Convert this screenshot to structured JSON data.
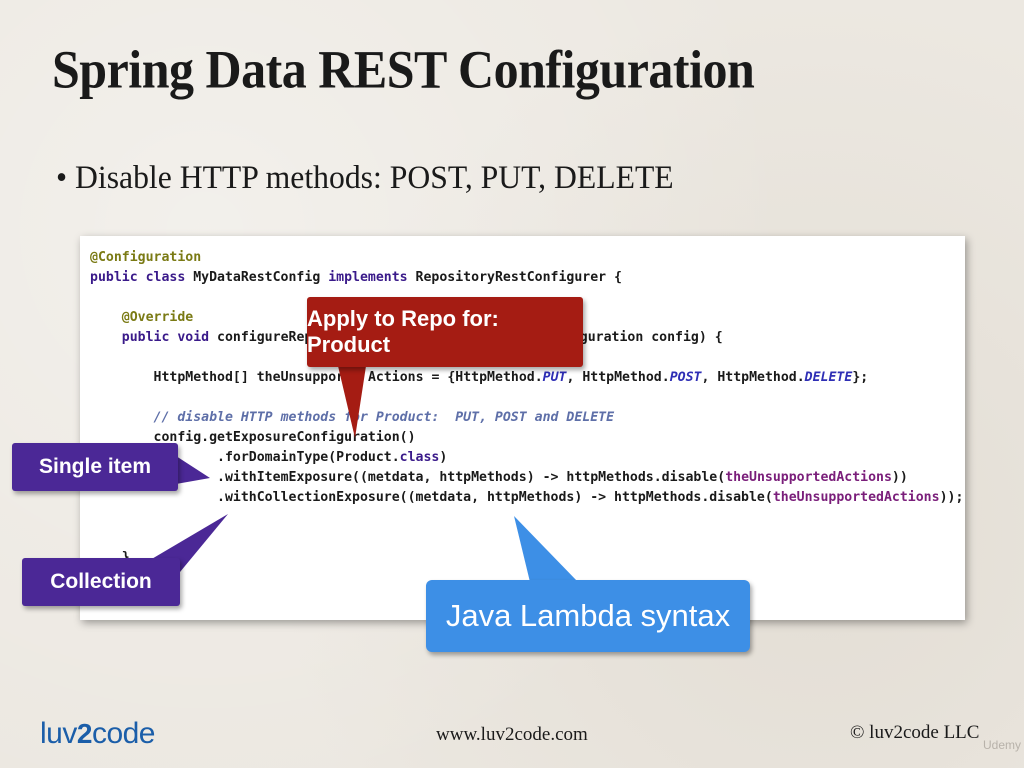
{
  "slide": {
    "title": "Spring Data REST Configuration",
    "bullet": "• Disable HTTP methods: POST, PUT, DELETE"
  },
  "code": {
    "line1": "@Configuration",
    "line2_kw": "public class",
    "line2_a": " MyDataRestConfig ",
    "line2_kw2": "implements",
    "line2_b": " RepositoryRestConfigurer {",
    "line4": "@Override",
    "line5_kw": "public void",
    "line5_a": " configureRepo",
    "line5_b": "estConfiguration config) {",
    "line7_a": "HttpMethod[] theUnsupporte",
    "line7_b": "Actions = {HttpMethod.",
    "line7_put": "PUT",
    "line7_c": ", HttpMethod.",
    "line7_post": "POST",
    "line7_d": ", HttpMethod.",
    "line7_delete": "DELETE",
    "line7_e": "};",
    "line9": "// disable HTTP methods for Product:  PUT, POST and DELETE",
    "line10": "config.getExposureConfiguration()",
    "line11_a": ".forDomainType(Product.",
    "line11_kw": "class",
    "line11_b": ")",
    "line12_a": ".withItemExposure((metdata, httpMethods) -> httpMethods.disable(",
    "line12_var": "theUnsupportedActions",
    "line12_b": "))",
    "line13_a": ".withCollectionExposure((metdata, httpMethods) -> httpMethods.disable(",
    "line13_var": "theUnsupportedActions",
    "line13_b": "));",
    "line16": "}"
  },
  "callouts": {
    "product": "Apply to Repo for: Product",
    "single_item": "Single item",
    "collection": "Collection",
    "lambda": "Java Lambda syntax"
  },
  "footer": {
    "logo_a": "luv",
    "logo_2": "2",
    "logo_b": "code",
    "url": "www.luv2code.com",
    "copyright": "© luv2code LLC",
    "watermark": "Udemy"
  },
  "colors": {
    "callout_red": "#a51c13",
    "callout_purple": "#4b2896",
    "callout_blue": "#3d8fe6",
    "logo_blue": "#1b5ea9"
  }
}
